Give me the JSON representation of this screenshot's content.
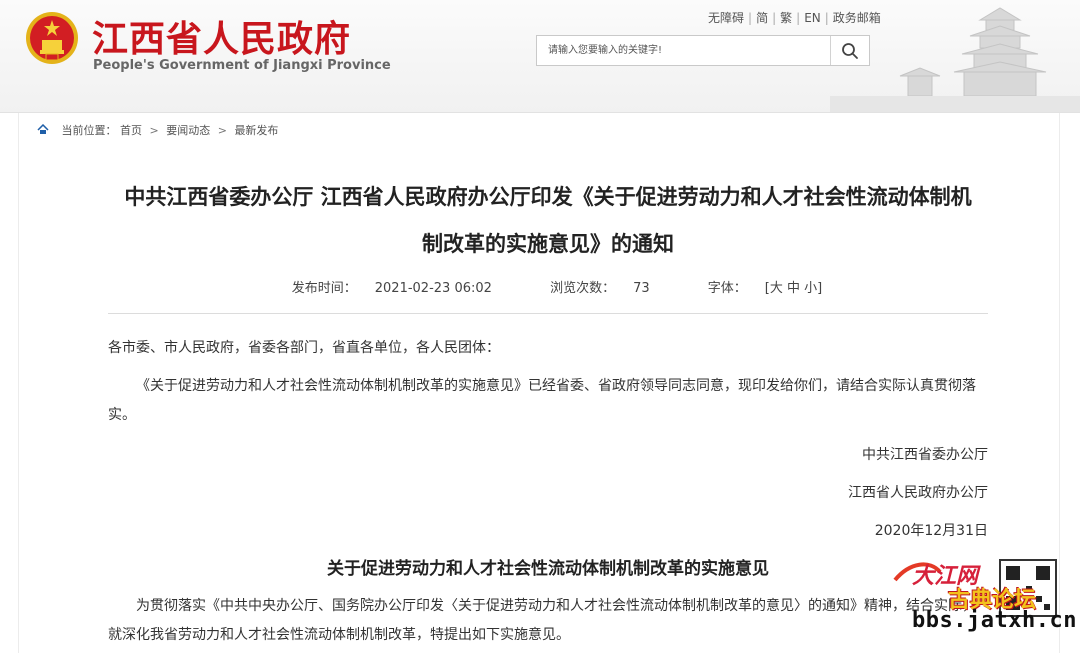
{
  "header": {
    "site_name": "江西省人民政府",
    "site_name_en": "People's Government of Jiangxi Province",
    "links": [
      "无障碍",
      "简",
      "繁",
      "EN",
      "政务邮箱"
    ],
    "search_placeholder": "请输入您要输入的关键字!",
    "brand_color": "#c8161d"
  },
  "breadcrumb": {
    "prefix": "当前位置：",
    "items": [
      "首页",
      "要闻动态",
      "最新发布"
    ],
    "separator": ">"
  },
  "article": {
    "title_line1": "中共江西省委办公厅 江西省人民政府办公厅印发《关于促进劳动力和人才社会性流动体制机",
    "title_line2": "制改革的实施意见》的通知",
    "publish_label": "发布时间：",
    "publish_time": "2021-02-23 06:02",
    "views_label": "浏览次数：",
    "views": "73",
    "font_label": "字体：",
    "font_sizes": [
      "[大",
      "中",
      "小]"
    ],
    "salutation": "各市委、市人民政府，省委各部门，省直各单位，各人民团体：",
    "body_para": "《关于促进劳动力和人才社会性流动体制机制改革的实施意见》已经省委、省政府领导同志同意，现印发给你们，请结合实际认真贯彻落实。",
    "sign1": "中共江西省委办公厅",
    "sign2": "江西省人民政府办公厅",
    "date": "2020年12月31日",
    "subtitle": "关于促进劳动力和人才社会性流动体制机制改革的实施意见",
    "body_para2": "为贯彻落实《中共中央办公厅、国务院办公厅印发〈关于促进劳动力和人才社会性流动体制机制改革的意见〉的通知》精神，结合实际，就深化我省劳动力和人才社会性流动体制机制改革，特提出如下实施意见。"
  },
  "watermark": {
    "brand": "大江网",
    "forum": "古典论坛",
    "url": "bbs.jatxh.cn"
  }
}
